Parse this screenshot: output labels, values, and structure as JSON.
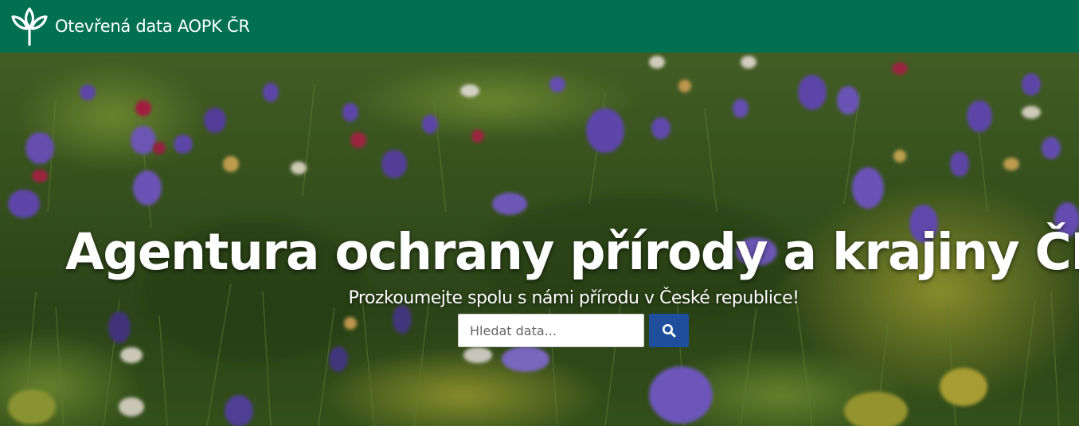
{
  "header": {
    "brand_text": "Otevřená data AOPK ČR",
    "logo_icon": "sprout-leaves-icon",
    "background_color": "#007050"
  },
  "hero": {
    "title": "Agentura ochrany přírody a krajiny ČR",
    "subtitle": "Prozkoumejte spolu s námi přírodu v České republice!",
    "background": "meadow-with-purple-flowers-photo"
  },
  "search": {
    "placeholder": "Hledat data...",
    "value": "",
    "button_icon": "search-icon",
    "button_color": "#1f4e9c"
  }
}
